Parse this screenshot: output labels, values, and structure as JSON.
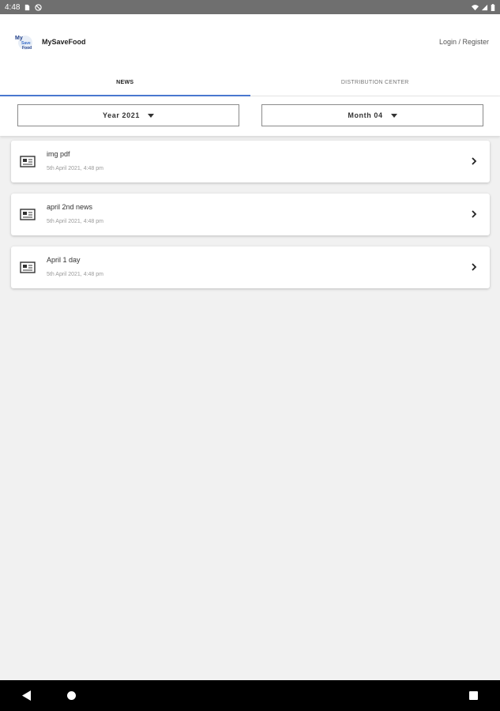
{
  "status_bar": {
    "time": "4:48"
  },
  "header": {
    "app_title": "MySaveFood",
    "login_label": "Login / Register"
  },
  "tabs": [
    {
      "label": "NEWS",
      "active": true
    },
    {
      "label": "DISTRIBUTION CENTER",
      "active": false
    }
  ],
  "filters": {
    "year_label": "Year 2021",
    "month_label": "Month 04"
  },
  "news": [
    {
      "title": "img pdf",
      "date": "5th April 2021, 4:48 pm"
    },
    {
      "title": "april 2nd news",
      "date": "5th April 2021, 4:48 pm"
    },
    {
      "title": "April 1 day",
      "date": "5th April 2021, 4:48 pm"
    }
  ],
  "colors": {
    "accent": "#4a78d0",
    "status_bar": "#6f6f6f",
    "nav_bar": "#000000"
  },
  "icons": [
    "sim-card-icon",
    "no-sync-icon",
    "wifi-icon",
    "signal-icon",
    "battery-icon",
    "newspaper-icon",
    "chevron-right-icon",
    "back-icon",
    "home-icon",
    "recents-icon"
  ]
}
